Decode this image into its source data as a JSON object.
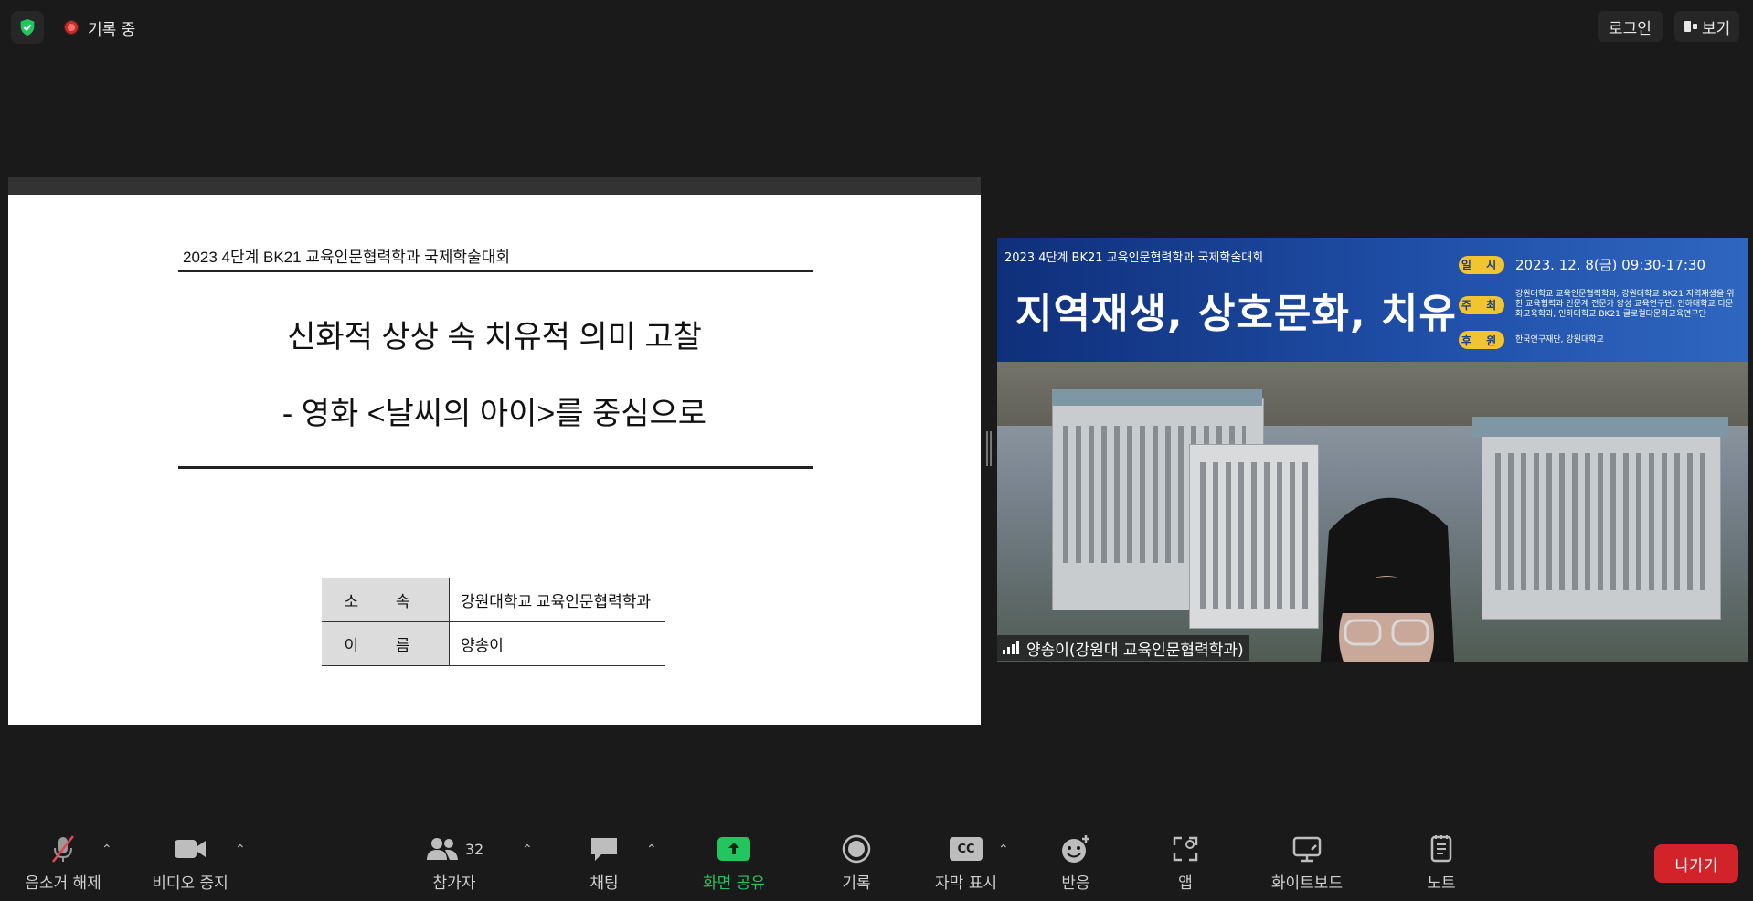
{
  "topbar": {
    "recording_label": "기록 중",
    "login_label": "로그인",
    "view_label": "보기"
  },
  "slide": {
    "event_title": "2023 4단계 BK21 교육인문협력학과 국제학술대회",
    "title_line1": "신화적 상상 속 치유적 의미 고찰",
    "title_line2": "- 영화 <날씨의 아이>를 중심으로",
    "info_rows": [
      {
        "key": "소 속",
        "value": "강원대학교 교육인문협력학과"
      },
      {
        "key": "이 름",
        "value": "양송이"
      }
    ]
  },
  "video": {
    "banner_event": "2023 4단계 BK21 교육인문협력학과 국제학술대회",
    "banner_title": "지역재생, 상호문화, 치유",
    "date_tag": "일 시",
    "date_text": "2023. 12. 8(금) 09:30-17:30",
    "host_tag": "주 최",
    "host_text": "강원대학교 교육인문협력학과, 강원대학교 BK21 지역재생을 위한 교육협력과 인문계 전문가 양성 교육연구단, 인하대학교 다문화교육학과, 인하대학교 BK21 글로컬다문화교육연구단",
    "sponsor_tag": "후 원",
    "sponsor_text": "한국연구재단, 강원대학교",
    "participant_name": "양송이(강원대 교육인문협력학과)"
  },
  "toolbar": {
    "mute": "음소거 해제",
    "video": "비디오 중지",
    "participants": "참가자",
    "participants_count": "32",
    "chat": "채팅",
    "share": "화면 공유",
    "record": "기록",
    "captions": "자막 표시",
    "captions_icon": "CC",
    "reactions": "반응",
    "apps": "앱",
    "whiteboard": "화이트보드",
    "notes": "노트",
    "leave": "나가기"
  },
  "colors": {
    "background": "#1a1a1a",
    "share_green": "#22c55e",
    "leave_red": "#d2232a",
    "banner_blue": "#1f4ea6",
    "tag_yellow": "#f2c530"
  }
}
